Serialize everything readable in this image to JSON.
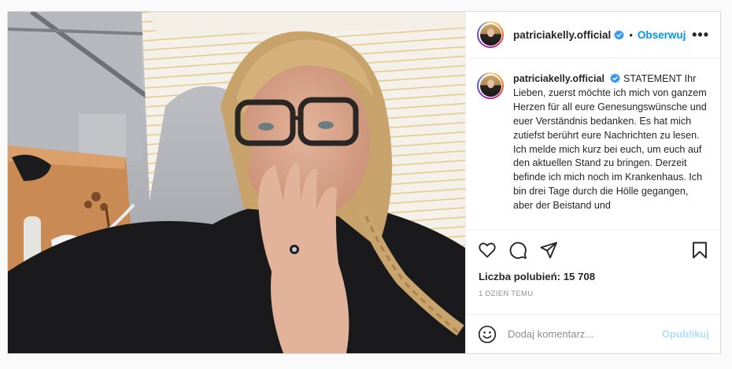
{
  "post": {
    "author": {
      "username": "patriciakelly.official",
      "verified": true,
      "follow_label": "Obserwuj",
      "separator": "•"
    },
    "more_label": "•••",
    "caption": {
      "username": "patriciakelly.official",
      "text": "STATEMENT Ihr Lieben, zuerst möchte ich mich von ganzem Herzen für all eure Genesungswünsche und euer Verständnis bedanken. Es hat mich zutiefst berührt eure Nachrichten zu lesen. Ich melde mich kurz bei euch, um euch auf den aktuellen Stand zu bringen. Derzeit befinde ich mich noch im Krankenhaus. Ich bin drei Tage durch die Hölle gegangen, aber der Beistand und"
    },
    "actions": {
      "like_icon": "heart-icon",
      "comment_icon": "comment-icon",
      "share_icon": "paper-plane-icon",
      "save_icon": "bookmark-icon"
    },
    "likes_text": "Liczba polubień: 15 708",
    "time_ago": "1 DZIEŃ TEMU",
    "comment_box": {
      "placeholder": "Dodaj komentarz...",
      "publish_label": "Opublikuj",
      "emoji_icon": "emoji-icon"
    }
  },
  "colors": {
    "accent": "#0095f6",
    "publish_disabled": "#b2dffc",
    "verified": "#3897f0",
    "muted": "#8e8e8e",
    "border": "#dbdbdb"
  }
}
